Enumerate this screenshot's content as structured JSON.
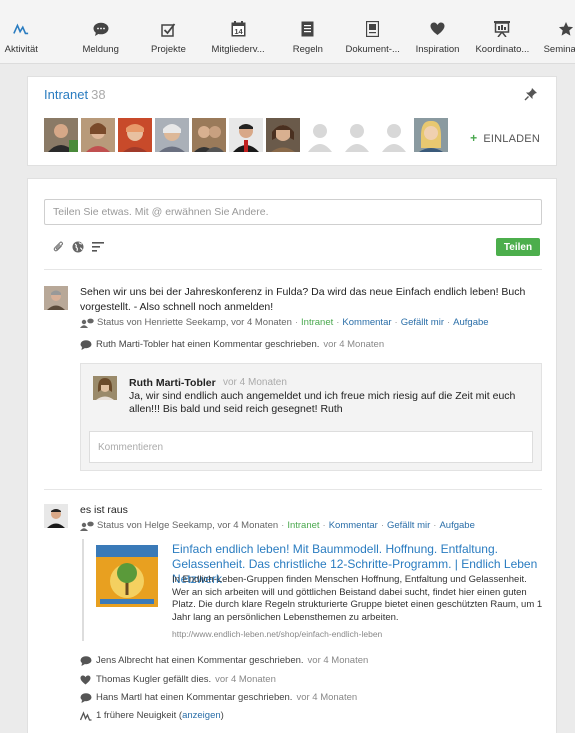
{
  "nav": {
    "items": [
      {
        "label": "Aktivität",
        "icon": "activity-icon"
      },
      {
        "label": "Meldung",
        "icon": "speech-bubble-icon"
      },
      {
        "label": "Projekte",
        "icon": "checkbox-icon"
      },
      {
        "label": "Mitgliederv...",
        "icon": "calendar-icon"
      },
      {
        "label": "Regeln",
        "icon": "document-icon"
      },
      {
        "label": "Dokument-...",
        "icon": "file-icon"
      },
      {
        "label": "Inspiration",
        "icon": "heart-icon"
      },
      {
        "label": "Koordinato...",
        "icon": "presentation-icon"
      },
      {
        "label": "Seminar",
        "icon": "star-icon"
      }
    ],
    "calendar_day": "14"
  },
  "intranet": {
    "title": "Intranet",
    "member_count": "38",
    "invite_label": "EINLADEN",
    "invite_plus": "+"
  },
  "composer": {
    "placeholder": "Teilen Sie etwas. Mit @ erwähnen Sie Andere.",
    "share_label": "Teilen"
  },
  "posts": [
    {
      "text": "Sehen wir uns bei der Jahreskonferenz in Fulda? Da wird das neue Einfach endlich leben! Buch vorgestellt. - Also schnell noch anmelden!",
      "meta": "Status von Henriette Seekamp, vor 4 Monaten",
      "group": "Intranet",
      "actions": [
        "Kommentar",
        "Gefällt mir",
        "Aufgabe"
      ],
      "activity": {
        "text": "Ruth Marti-Tobler hat einen Kommentar geschrieben.",
        "time": "vor 4 Monaten"
      },
      "comment": {
        "author": "Ruth Marti-Tobler",
        "time": "vor 4 Monaten",
        "text": "Ja, wir sind endlich auch angemeldet und ich freue mich riesig auf die Zeit mit euch allen!!! Bis bald und seid reich gesegnet! Ruth"
      },
      "comment_placeholder": "Kommentieren"
    },
    {
      "text": "es ist raus",
      "meta": "Status von Helge Seekamp, vor 4 Monaten",
      "group": "Intranet",
      "actions": [
        "Kommentar",
        "Gefällt mir",
        "Aufgabe"
      ],
      "link": {
        "title": "Einfach endlich leben! Mit Baummodell. Hoffnung. Entfaltung. Gelassenheit. Das christliche 12-Schritte-Programm. | Endlich Leben Netzwerk",
        "description": "In Endlich-Leben-Gruppen finden Menschen Hoffnung, Entfaltung und Gelassenheit. Wer an sich arbeiten will und göttlichen Beistand dabei sucht, findet hier einen guten Platz. Die durch klare Regeln strukturierte Gruppe bietet einen geschützten Raum, um 1 Jahr lang an persönlichen Lebensthemen zu arbeiten.",
        "url": "http://www.endlich-leben.net/shop/einfach-endlich-leben"
      },
      "activities": [
        {
          "text": "Jens Albrecht hat einen Kommentar geschrieben.",
          "time": "vor 4 Monaten",
          "icon": "comment-icon"
        },
        {
          "text": "Thomas Kugler gefällt dies.",
          "time": "vor 4 Monaten",
          "icon": "heart-icon"
        },
        {
          "text": "Hans Martl hat einen Kommentar geschrieben.",
          "time": "vor 4 Monaten",
          "icon": "comment-icon"
        }
      ],
      "older": {
        "prefix": "1 frühere Neuigkeit (",
        "link": "anzeigen",
        "suffix": ")"
      }
    }
  ],
  "colors": {
    "accent": "#2a7cc0",
    "green": "#4cae4c",
    "link": "#2a6ea8"
  }
}
